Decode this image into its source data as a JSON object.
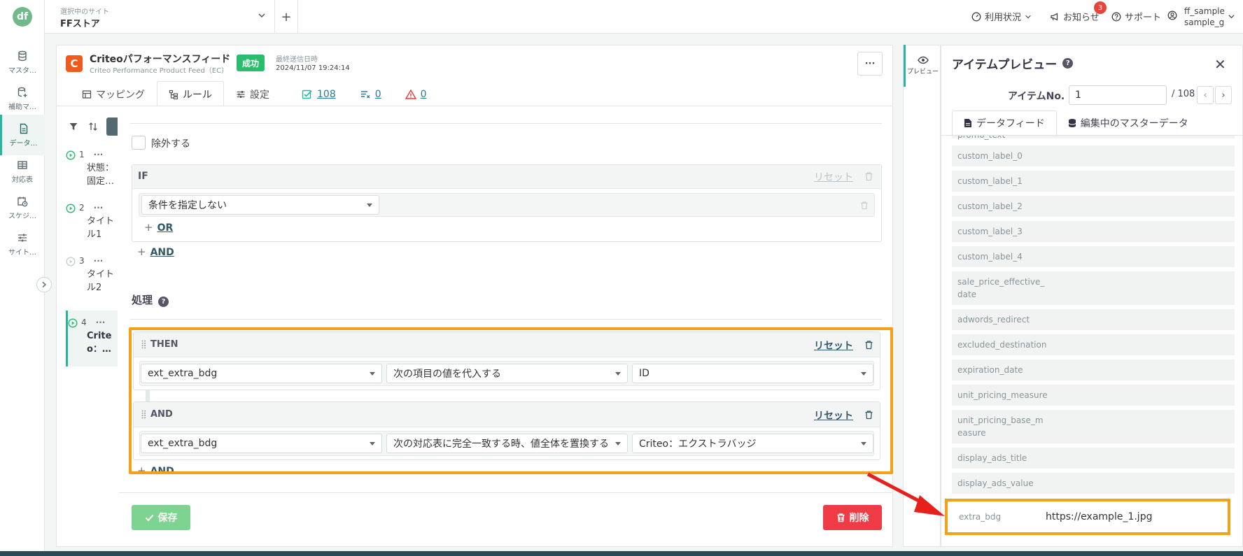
{
  "rail": {
    "items": [
      {
        "label": "マスタ…",
        "icon": "database-icon"
      },
      {
        "label": "補助マ…",
        "icon": "database-plus-icon"
      },
      {
        "label": "データ…",
        "icon": "document-icon"
      },
      {
        "label": "対応表",
        "icon": "table-icon"
      },
      {
        "label": "スケジ…",
        "icon": "calendar-clock-icon"
      },
      {
        "label": "サイト…",
        "icon": "sliders-icon"
      }
    ]
  },
  "header": {
    "site_caption": "選択中のサイト",
    "site_name": "FFストア",
    "usage": "利用状況",
    "news": "お知らせ",
    "news_badge": "3",
    "support": "サポート",
    "user_line1": "ff_sample",
    "user_line2": "sample_g"
  },
  "feed": {
    "icon_letter": "C",
    "title": "Criteoパフォーマンスフィード",
    "subtitle": "Criteo Performance Product Feed（EC）",
    "status": "成功",
    "last_sent_caption": "最終送信日時",
    "last_sent": "2024/11/07 19:24:14",
    "more": "···"
  },
  "tabs": [
    {
      "label": "マッピング"
    },
    {
      "label": "ルール"
    },
    {
      "label": "設定"
    },
    {
      "label": "108"
    },
    {
      "label": "0"
    },
    {
      "label": "0"
    }
  ],
  "rules": {
    "items": [
      {
        "num": "1",
        "text": "状態：固定…"
      },
      {
        "num": "2",
        "text": "タイトル1"
      },
      {
        "num": "3",
        "text": "タイトル2"
      },
      {
        "num": "4",
        "text": "Criteo：…"
      }
    ]
  },
  "editor": {
    "exclude_label": "除外する",
    "if_label": "IF",
    "reset": "リセット",
    "condition_value": "条件を指定しない",
    "or_label": "OR",
    "and_label": "AND",
    "process_title": "処理",
    "then_label": "THEN",
    "then_field": "ext_extra_bdg",
    "then_op": "次の項目の値を代入する",
    "then_value": "ID",
    "and_block_label": "AND",
    "and_field": "ext_extra_bdg",
    "and_op": "次の対応表に完全一致する時、値全体を置換する",
    "and_value": "Criteo：エクストラバッジ",
    "and_add": "AND",
    "save": "保存",
    "delete": "削除"
  },
  "preview": {
    "strip_label": "プレビュー",
    "title": "アイテムプレビュー",
    "item_no_label": "アイテムNo.",
    "item_no": "1",
    "item_total": "/ 108",
    "tab_feed": "データフィード",
    "tab_master": "編集中のマスターデータ",
    "partial_top": "promo_text",
    "fields": [
      {
        "key": "custom_label_0",
        "value": ""
      },
      {
        "key": "custom_label_1",
        "value": ""
      },
      {
        "key": "custom_label_2",
        "value": ""
      },
      {
        "key": "custom_label_3",
        "value": ""
      },
      {
        "key": "custom_label_4",
        "value": ""
      },
      {
        "key": "sale_price_effective_date",
        "value": ""
      },
      {
        "key": "adwords_redirect",
        "value": ""
      },
      {
        "key": "excluded_destination",
        "value": ""
      },
      {
        "key": "expiration_date",
        "value": ""
      },
      {
        "key": "unit_pricing_measure",
        "value": ""
      },
      {
        "key": "unit_pricing_base_measure",
        "value": ""
      },
      {
        "key": "display_ads_title",
        "value": ""
      },
      {
        "key": "display_ads_value",
        "value": ""
      }
    ],
    "extra_key": "extra_bdg",
    "extra_value": "https://example_1.jpg"
  },
  "colors": {
    "accent": "#2bb5a0",
    "highlight": "#f5a019",
    "success": "#2bbd6e",
    "danger": "#ee3b46",
    "arrow": "#e8201c"
  }
}
